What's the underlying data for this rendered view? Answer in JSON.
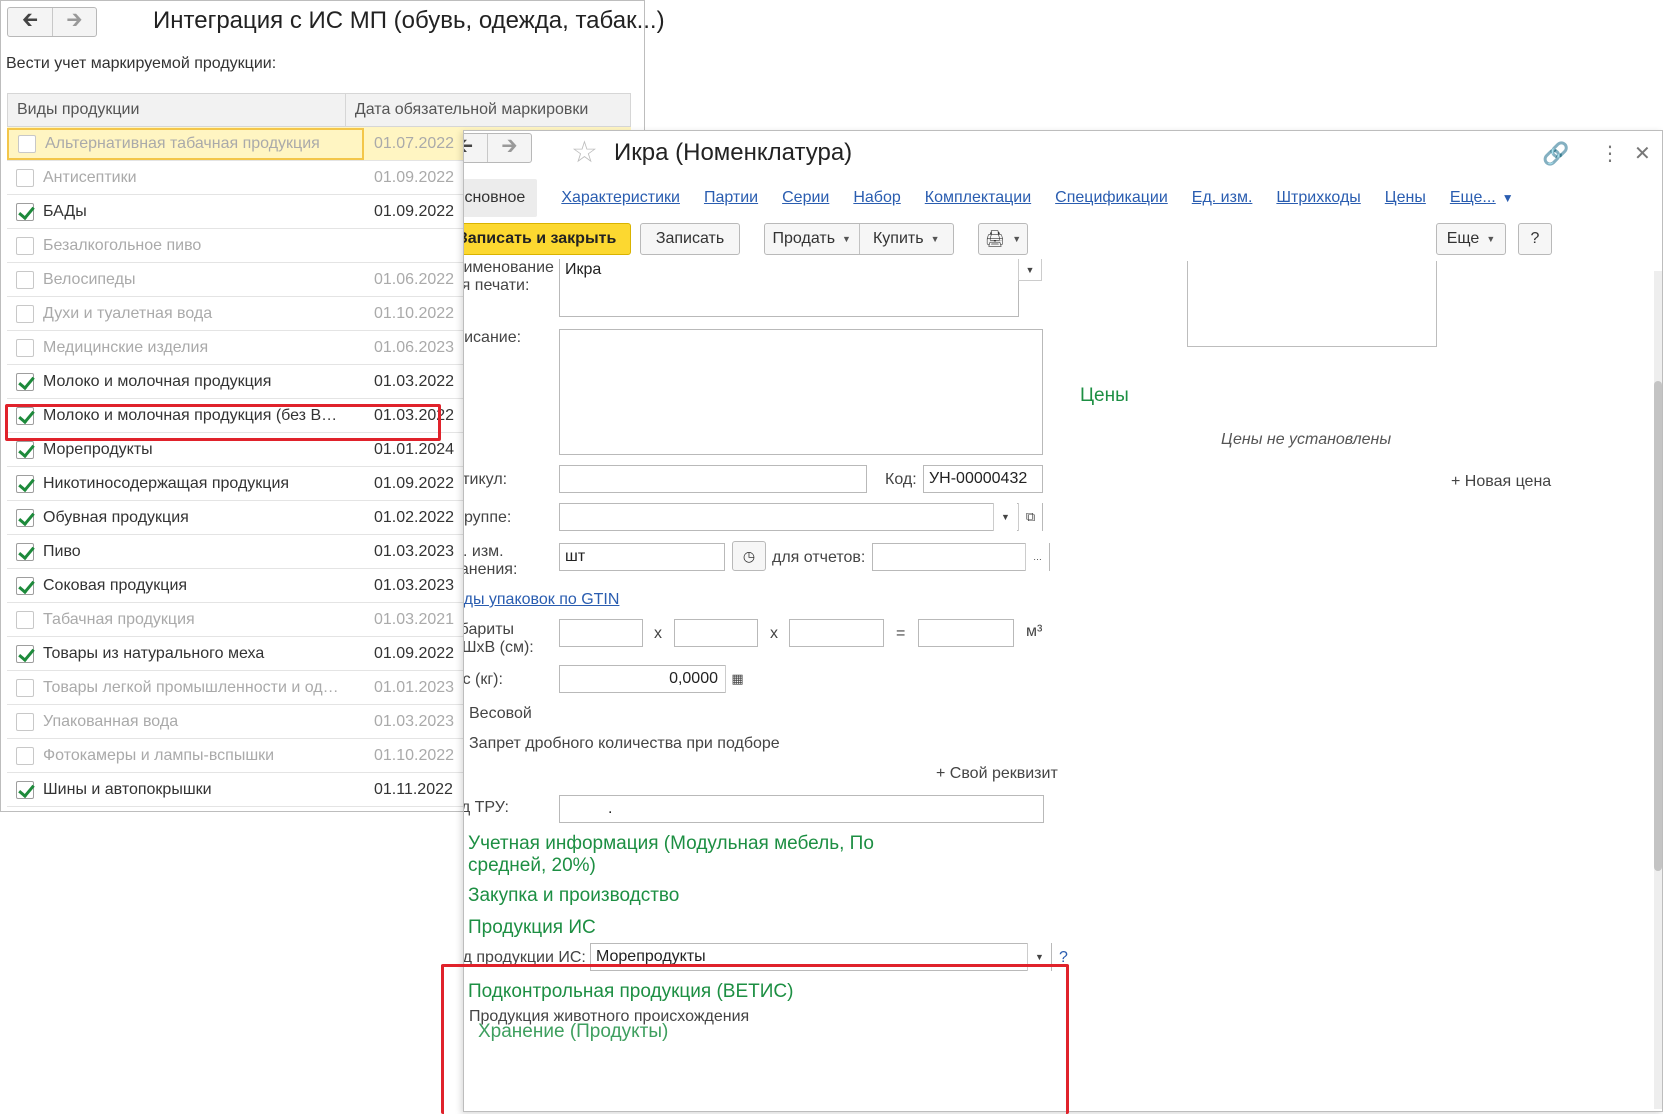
{
  "win1": {
    "title": "Интеграция с ИС МП (обувь, одежда, табак...)",
    "subtitle": "Вести учет маркируемой продукции:",
    "columns": [
      "Виды продукции",
      "Дата обязательной маркировки"
    ],
    "rows": [
      {
        "name": "Альтернативная табачная продукция",
        "date": "01.07.2022",
        "checked": false,
        "dim": true
      },
      {
        "name": "Антисептики",
        "date": "01.09.2022",
        "checked": false,
        "dim": true
      },
      {
        "name": "БАДы",
        "date": "01.09.2022",
        "checked": true,
        "dim": false
      },
      {
        "name": "Безалкогольное пиво",
        "date": "",
        "checked": false,
        "dim": true
      },
      {
        "name": "Велосипеды",
        "date": "01.06.2022",
        "checked": false,
        "dim": true
      },
      {
        "name": "Духи и туалетная вода",
        "date": "01.10.2022",
        "checked": false,
        "dim": true
      },
      {
        "name": "Медицинские изделия",
        "date": "01.06.2023",
        "checked": false,
        "dim": true
      },
      {
        "name": "Молоко и молочная продукция",
        "date": "01.03.2022",
        "checked": true,
        "dim": false
      },
      {
        "name": "Молоко и молочная продукция (без В…",
        "date": "01.03.2022",
        "checked": true,
        "dim": false
      },
      {
        "name": "Морепродукты",
        "date": "01.01.2024",
        "checked": true,
        "dim": false
      },
      {
        "name": "Никотиносодержащая продукция",
        "date": "01.09.2022",
        "checked": true,
        "dim": false
      },
      {
        "name": "Обувная продукция",
        "date": "01.02.2022",
        "checked": true,
        "dim": false
      },
      {
        "name": "Пиво",
        "date": "01.03.2023",
        "checked": true,
        "dim": false
      },
      {
        "name": "Соковая продукция",
        "date": "01.03.2023",
        "checked": true,
        "dim": false
      },
      {
        "name": "Табачная продукция",
        "date": "01.03.2021",
        "checked": false,
        "dim": true
      },
      {
        "name": "Товары из натурального меха",
        "date": "01.09.2022",
        "checked": true,
        "dim": false
      },
      {
        "name": "Товары легкой промышленности и од…",
        "date": "01.01.2023",
        "checked": false,
        "dim": true
      },
      {
        "name": "Упакованная вода",
        "date": "01.03.2023",
        "checked": false,
        "dim": true
      },
      {
        "name": "Фотокамеры и лампы-вспышки",
        "date": "01.10.2022",
        "checked": false,
        "dim": true
      },
      {
        "name": "Шины и автопокрышки",
        "date": "01.11.2022",
        "checked": true,
        "dim": false
      }
    ]
  },
  "win2": {
    "title": "Икра (Номенклатура)",
    "tabs": [
      "Основное",
      "Характеристики",
      "Партии",
      "Серии",
      "Набор",
      "Комплектации",
      "Спецификации",
      "Ед. изм.",
      "Штрихкоды",
      "Цены",
      "Еще..."
    ],
    "buttons": {
      "save_close": "Записать и закрыть",
      "save": "Записать",
      "sell": "Продать",
      "buy": "Купить",
      "more": "Еще",
      "help": "?"
    },
    "form": {
      "print_name_label": "Наименование для печати:",
      "print_name_value": "Икра",
      "description_label": "Описание:",
      "article_label": "Артикул:",
      "code_label": "Код:",
      "code_value": "УН-00000432",
      "group_label": "В группе:",
      "unit_label": "Ед. изм. хранения:",
      "unit_value": "шт",
      "reports_label": "для отчетов:",
      "gtin_link": "Виды упаковок по GTIN",
      "dims_label": "Габариты ДхШхВ (см):",
      "x1": "x",
      "x2": "x",
      "eq": "=",
      "m3": "м³",
      "weight_label": "Вес (кг):",
      "weight_value": "0,0000",
      "weighted_label": "Весовой",
      "fraction_label": "Запрет дробного количества при подборе",
      "own_attr": "+ Свой реквизит",
      "tru_label": "Код ТРУ:",
      "tru_value": "."
    },
    "prices": {
      "title": "Цены",
      "empty": "Цены не установлены",
      "new_price": "+ Новая цена"
    },
    "sections": {
      "accounting": "Учетная информация (Модульная мебель, По средней, 20%)",
      "purchase": "Закупка и производство",
      "is_products": "Продукция ИС",
      "is_type_label": "Вид продукции ИС:",
      "is_type_value": "Морепродукты",
      "is_help": "?",
      "vetis": "Подконтрольная продукция (ВЕТИС)",
      "animal_origin": "Продукция животного происхождения",
      "storage": "Хранение (Продукты)"
    }
  },
  "colors": {
    "accent_green": "#1d8f43",
    "link_blue": "#2a5db0",
    "highlight_red": "#e0222b",
    "button_yellow": "#fcd830"
  }
}
